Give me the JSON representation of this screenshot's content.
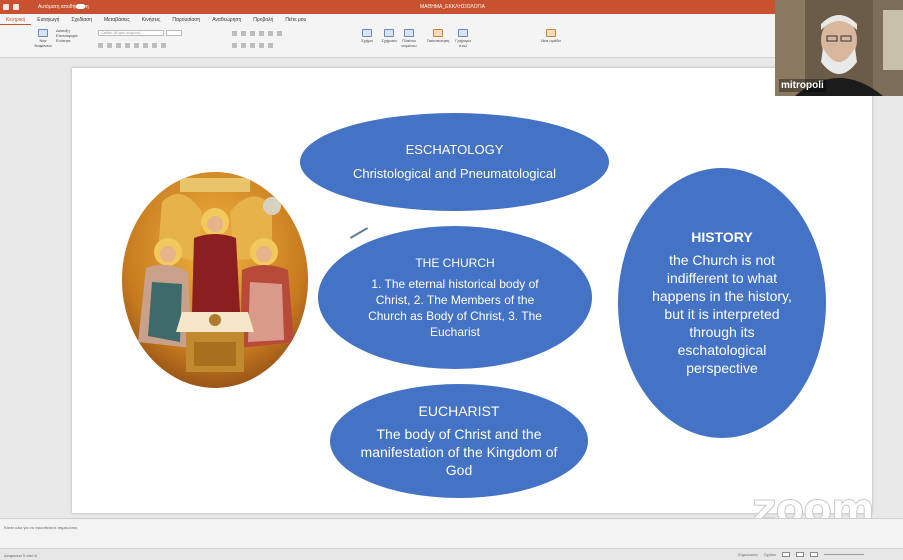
{
  "titlebar": {
    "autosave_label": "Αυτόματη αποθήκευση",
    "document_title": "ΜΑΘΗΜΑ_ΕΚΚΛΗΣΙΟΛΟΓΙΑ"
  },
  "ribbon_tabs": [
    "Κεντρική",
    "Εισαγωγή",
    "Σχεδίαση",
    "Μεταβάσεις",
    "Κινήσεις",
    "Παρουσίαση",
    "Αναθεώρηση",
    "Προβολή",
    "Πείτε μου"
  ],
  "ribbon": {
    "font_name": "Calibri (Κύριο κείμενο)",
    "buttons": [
      "Νέα διαφάνεια",
      "Διάταξη",
      "Επαναφορά",
      "Ενότητα",
      "Σχήμα",
      "Σχήματα",
      "Πλαίσιο κειμένου",
      "Τακτοποίηση",
      "Γρήγορα στυλ",
      "Νέα ομάδα"
    ]
  },
  "slide": {
    "eschatology": {
      "title": "ESCHATOLOGY",
      "body": "Christological and Pneumatological"
    },
    "church": {
      "title": "THE CHURCH",
      "body": "1. The eternal historical body of Christ, 2. The Members of the Church as Body of Christ, 3. The  Eucharist"
    },
    "eucharist": {
      "title": "EUCHARIST",
      "body": "The body of Christ and the manifestation of the Kingdom of God"
    },
    "history": {
      "title": "HISTORY",
      "body": "the Church is not indifferent to what happens in the history, but it is interpreted through its eschatological perspective"
    },
    "colors": {
      "ellipse_fill": "#4472c4",
      "text": "#ffffff"
    }
  },
  "video": {
    "participant_name": "mitropoli"
  },
  "watermark": "zoom",
  "notes": {
    "placeholder": "Κάντε κλικ για να προσθέσετε σημειώσεις"
  },
  "statusbar": {
    "slide_info": "Διαφάνεια 5 από 6",
    "notes_label": "Σημειώσεις",
    "comments_label": "Σχόλια"
  }
}
